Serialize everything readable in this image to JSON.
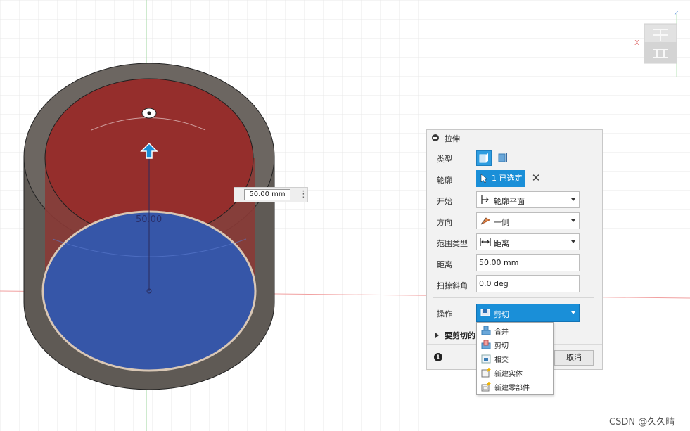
{
  "viewport": {
    "dimension_label": "50.00",
    "dimension_input": "50.00 mm",
    "axis_x": "X",
    "axis_z": "Z",
    "colors": {
      "profile_red": "#8e2a2a",
      "selected_blue": "#3656a8",
      "body_gray": "#5f5a55",
      "arrow_blue": "#1a8fd8"
    }
  },
  "panel": {
    "title": "拉伸",
    "labels": {
      "type": "类型",
      "profile": "轮廓",
      "start": "开始",
      "direction": "方向",
      "extent_type": "范围类型",
      "distance": "距离",
      "taper": "扫掠斜角",
      "operation": "操作"
    },
    "profile_selection": "1 已选定",
    "start_value": "轮廓平面",
    "direction_value": "一侧",
    "extent_value": "距离",
    "distance_value": "50.00 mm",
    "taper_value": "0.0 deg",
    "operation_value": "剪切",
    "bodies_to_cut": "要剪切的",
    "cancel": "取消"
  },
  "operation_menu": {
    "items": [
      "合并",
      "剪切",
      "相交",
      "新建实体",
      "新建零部件"
    ]
  },
  "watermark": "CSDN @久久晴"
}
